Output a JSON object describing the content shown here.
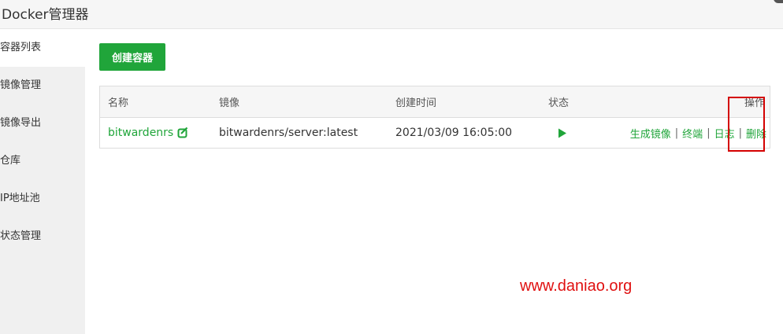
{
  "window": {
    "title": "Docker管理器"
  },
  "sidebar": {
    "items": [
      {
        "label": "容器列表"
      },
      {
        "label": "镜像管理"
      },
      {
        "label": "镜像导出"
      },
      {
        "label": "仓库"
      },
      {
        "label": "IP地址池"
      },
      {
        "label": "状态管理"
      }
    ]
  },
  "main": {
    "create_button": "创建容器",
    "table": {
      "headers": {
        "name": "名称",
        "image": "镜像",
        "created": "创建时间",
        "status": "状态",
        "ops": "操作"
      },
      "rows": [
        {
          "name": "bitwardenrs",
          "image": "bitwardenrs/server:latest",
          "created": "2021/03/09 16:05:00",
          "status_icon": "play-icon",
          "ops": {
            "gen_image": "生成镜像",
            "terminal": "终端",
            "log": "日志",
            "delete": "删除",
            "separator": "|"
          }
        }
      ]
    }
  },
  "watermark": "www.daniao.org",
  "colors": {
    "accent": "#20a53a",
    "highlight": "#d40000"
  }
}
